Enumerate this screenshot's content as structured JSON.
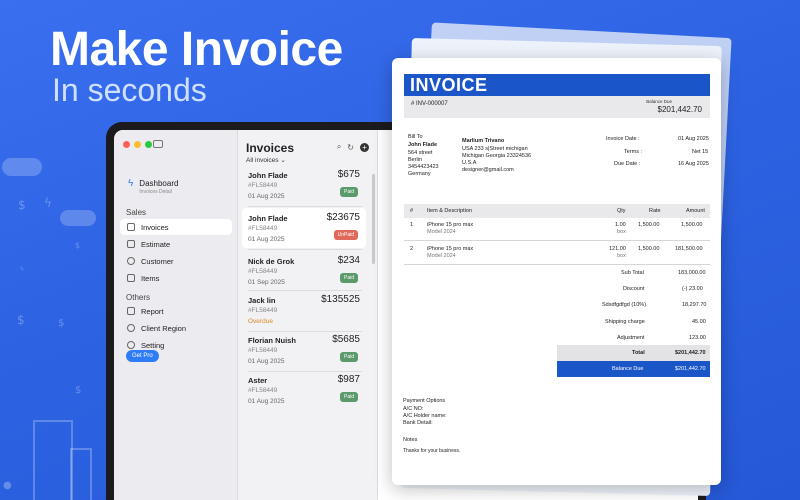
{
  "hero": {
    "title": "Make Invoice",
    "subtitle": "In seconds"
  },
  "colors": {
    "brand": "#2c63e4",
    "accent": "#1b56c8",
    "paid": "#5a9a6b",
    "unpaid": "#e06a5a",
    "overdue": "#e0882b"
  },
  "sidebar": {
    "dashboard": {
      "label": "Dashboard",
      "sub": "Invoices Detail"
    },
    "sales_header": "Sales",
    "sales_items": [
      {
        "label": "Invoices",
        "icon": "document-icon"
      },
      {
        "label": "Estimate",
        "icon": "estimate-icon"
      },
      {
        "label": "Customer",
        "icon": "person-icon"
      },
      {
        "label": "Items",
        "icon": "bag-icon"
      }
    ],
    "others_header": "Others",
    "others_items": [
      {
        "label": "Report",
        "icon": "chart-icon"
      },
      {
        "label": "Client Region",
        "icon": "globe-icon"
      },
      {
        "label": "Setting",
        "icon": "gear-icon"
      }
    ],
    "get_pro": "Get Pro"
  },
  "list": {
    "title": "Invoices",
    "filter": "All invoices",
    "items": [
      {
        "name": "John Flade",
        "amount": "$675",
        "number": "#FL58449",
        "date": "01 Aug 2025",
        "status": "Paid"
      },
      {
        "name": "John Flade",
        "amount": "$23675",
        "number": "#FL58449",
        "date": "01 Aug 2025",
        "status": "UnPaid"
      },
      {
        "name": "Nick de Grok",
        "amount": "$234",
        "number": "#FL58449",
        "date": "01 Sep 2025",
        "status": "Paid"
      },
      {
        "name": "Jack lin",
        "amount": "$135525",
        "number": "#FL58449",
        "date": "Overdue",
        "status": ""
      },
      {
        "name": "Florian Nuish",
        "amount": "$5685",
        "number": "#FL58449",
        "date": "01 Aug 2025",
        "status": "Paid"
      },
      {
        "name": "Aster",
        "amount": "$987",
        "number": "#FL58449",
        "date": "01 Aug 2025",
        "status": "Paid"
      }
    ]
  },
  "invoice": {
    "title": "INVOICE",
    "number": "# INV-000007",
    "balance_due_label": "Balance Due",
    "balance_due_value": "$201,442.70",
    "bill_to_label": "Bill To",
    "bill_to": {
      "name": "John Flade",
      "lines": [
        "564 street",
        "Berlin",
        "3454423423",
        "Germany"
      ]
    },
    "from": {
      "name": "Marlium Trivano",
      "lines": [
        "USA 233 s|Street michigan",
        "Michigan Georgia 23324536",
        "U.S.A",
        "designer@gmail.com"
      ]
    },
    "meta": [
      {
        "label": "Invoice Date :",
        "value": "01 Aug 2025"
      },
      {
        "label": "Terms :",
        "value": "Net 15"
      },
      {
        "label": "Due Date :",
        "value": "16 Aug 2025"
      }
    ],
    "columns": [
      "#",
      "Item & Description",
      "Qty",
      "Rate",
      "Amount"
    ],
    "rows": [
      {
        "no": "1",
        "item": "iPhone 15 pro max",
        "desc": "Model 2024",
        "qty": "1.00",
        "unit": "box",
        "rate": "1,500.00",
        "amount": "1,500.00"
      },
      {
        "no": "2",
        "item": "iPhone 15 pro max",
        "desc": "Model 2024",
        "qty": "121.00",
        "unit": "box",
        "rate": "1,500.00",
        "amount": "181,500.00"
      }
    ],
    "summary": [
      {
        "label": "Sub Total",
        "value": "183,000.00"
      },
      {
        "label": "Discount",
        "value": "(-) 23.00"
      },
      {
        "label": "Sdsdfgdfgd (10%)",
        "value": "18,297.70"
      },
      {
        "label": "Shipping charge",
        "value": "45.00"
      },
      {
        "label": "Adjustment",
        "value": "123.00"
      }
    ],
    "total_label": "Total",
    "total_value": "$201,442.70",
    "due_label": "Balance Due",
    "due_value": "$201,442.70",
    "payment_header": "Payment Options",
    "payment_lines": [
      "A/C NO:",
      "A/C Holder name:",
      "Bank Detail:"
    ],
    "notes_header": "Notes",
    "notes_text": "Thanks for your business."
  }
}
